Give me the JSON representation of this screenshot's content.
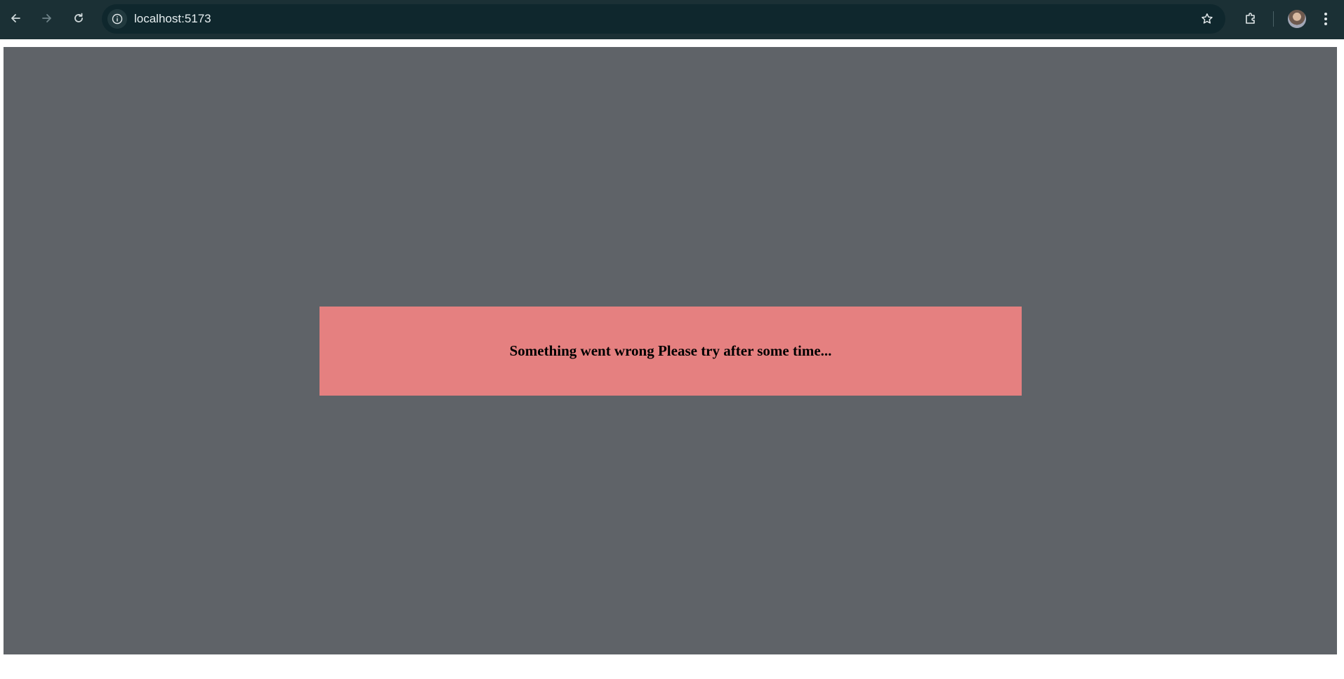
{
  "browser": {
    "url": "localhost:5173",
    "icons": {
      "back": "back-arrow-icon",
      "forward": "forward-arrow-icon",
      "reload": "reload-icon",
      "site_info": "info-icon",
      "bookmark": "star-icon",
      "extensions": "puzzle-icon",
      "profile": "avatar",
      "menu": "kebab-menu-icon"
    },
    "colors": {
      "toolbar": "#1b3035",
      "omnibox": "#0f272d"
    }
  },
  "page": {
    "background": "#5f6368",
    "error": {
      "message": "Something went wrong Please try after some time...",
      "background": "#e58080"
    }
  }
}
